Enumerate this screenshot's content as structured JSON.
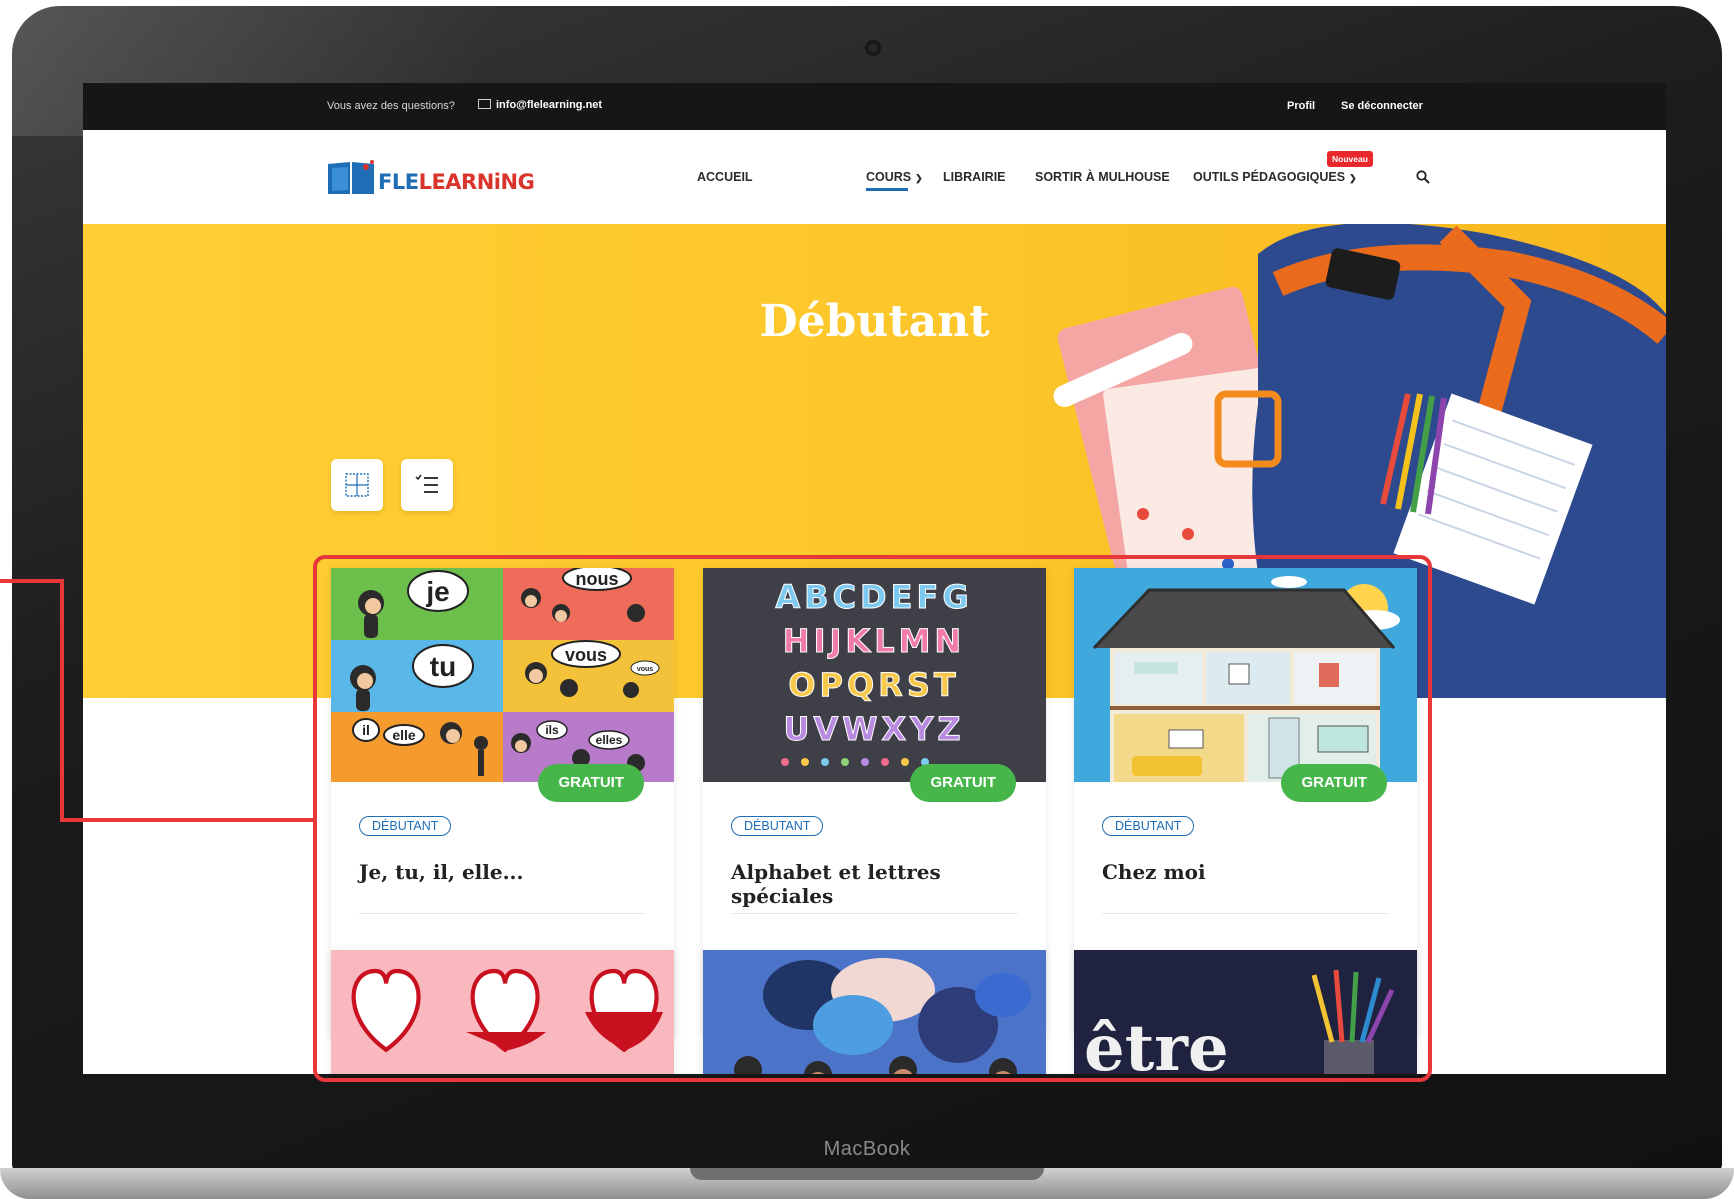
{
  "device": {
    "brand": "MacBook"
  },
  "topbar": {
    "question_text": "Vous avez des questions?",
    "email": "info@flelearning.net",
    "profile_link": "Profil",
    "logout_link": "Se déconnecter"
  },
  "logo": {
    "part1": "FLE",
    "part2": "LEARNiNG"
  },
  "nav": {
    "items": [
      "ACCUEIL",
      "COURS",
      "LIBRAIRIE",
      "SORTIR À MULHOUSE",
      "OUTILS PÉDAGOGIQUES"
    ],
    "active": "COURS",
    "new_badge": "Nouveau",
    "search_icon": "search-icon"
  },
  "hero": {
    "title": "Débutant"
  },
  "view_toggle": {
    "grid_icon": "grid-view-icon",
    "list_icon": "list-view-icon"
  },
  "courses": [
    {
      "title": "Je, tu, il, elle...",
      "level": "DÉBUTANT",
      "price": "GRATUIT",
      "image_words": [
        "je",
        "nous",
        "tu",
        "vous",
        "vous",
        "il",
        "elle",
        "ils",
        "elles"
      ]
    },
    {
      "title": "Alphabet et lettres spéciales",
      "level": "DÉBUTANT",
      "price": "GRATUIT",
      "image_letters": [
        "ABCDEFG",
        "HIJKLMN",
        "OPQRST",
        "UVWXYZ"
      ]
    },
    {
      "title": "Chez moi",
      "level": "DÉBUTANT",
      "price": "GRATUIT"
    },
    {
      "image": "hearts"
    },
    {
      "image": "speech-bubbles"
    },
    {
      "image_text": "être"
    }
  ],
  "colors": {
    "hero_yellow": "#fcc629",
    "brand_blue": "#1e6db5",
    "brand_red": "#d9342b",
    "price_green": "#46b54a",
    "highlight_red": "#e8373a",
    "topbar_dark": "#161616"
  }
}
